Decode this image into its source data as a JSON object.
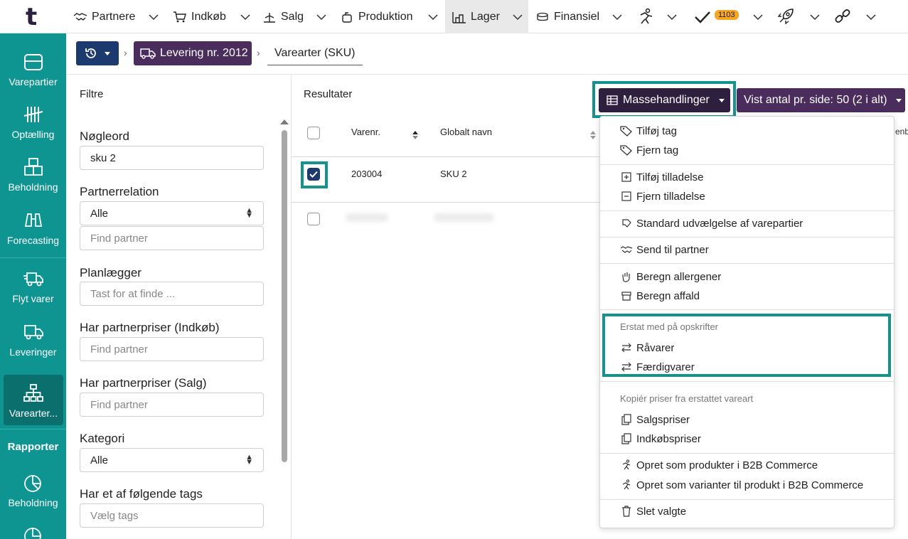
{
  "app": {
    "logo": "t"
  },
  "topnav": {
    "items": [
      {
        "label": "Partnere",
        "icon": "handshake-icon"
      },
      {
        "label": "Indkøb",
        "icon": "cart-icon"
      },
      {
        "label": "Salg",
        "icon": "scale-icon"
      },
      {
        "label": "Produktion",
        "icon": "pot-icon"
      },
      {
        "label": "Lager",
        "icon": "warehouse-icon"
      },
      {
        "label": "Finansiel",
        "icon": "coins-icon"
      }
    ],
    "badge": "1103"
  },
  "sidebar": {
    "items": [
      {
        "label": "Varepartier",
        "icon": "box-icon"
      },
      {
        "label": "Optælling",
        "icon": "tally-icon"
      },
      {
        "label": "Beholdning",
        "icon": "boxes-icon"
      },
      {
        "label": "Forecasting",
        "icon": "binoculars-icon"
      },
      {
        "label": "Flyt varer",
        "icon": "truck-move-icon"
      },
      {
        "label": "Leveringer",
        "icon": "truck-icon"
      },
      {
        "label": "Varearter...",
        "icon": "hierarchy-icon"
      },
      {
        "label": "Beholdning",
        "icon": "pie-chart-icon"
      }
    ],
    "section": "Rapporter"
  },
  "breadcrumb": {
    "delivery": "Levering nr. 2012",
    "current": "Varearter (SKU)"
  },
  "filters": {
    "title": "Filtre",
    "keyword_label": "Nøgleord",
    "keyword_value": "sku 2",
    "partner_relation_label": "Partnerrelation",
    "partner_relation_value": "Alle",
    "find_partner": "Find partner",
    "planner_label": "Planlægger",
    "planner_placeholder": "Tast for at finde ...",
    "partner_prices_purchase_label": "Har partnerpriser (Indkøb)",
    "partner_prices_sales_label": "Har partnerpriser (Salg)",
    "category_label": "Kategori",
    "category_value": "Alle",
    "tags_label": "Har et af følgende tags",
    "tags_placeholder": "Vælg tags"
  },
  "results": {
    "title": "Resultater",
    "mass_actions": "Massehandlinger",
    "per_page": "Vist antal pr. side: 50 (2 i alt)",
    "columns": [
      "Varenr.",
      "Globalt navn"
    ],
    "cut_column": "enb",
    "rows": [
      {
        "varenr": "203004",
        "name": "SKU 2",
        "checked": true
      }
    ]
  },
  "dropdown": {
    "add_tag": "Tilføj tag",
    "remove_tag": "Fjern tag",
    "add_permission": "Tilføj tilladelse",
    "remove_permission": "Fjern tilladelse",
    "default_selection": "Standard udvælgelse af varepartier",
    "send_to_partner": "Send til partner",
    "calc_allergens": "Beregn allergener",
    "calc_waste": "Beregn affald",
    "replace_header": "Erstat med på opskrifter",
    "raw_materials": "Råvarer",
    "finished_goods": "Færdigvarer",
    "copy_header": "Kopiér priser fra erstattet vareart",
    "sales_prices": "Salgspriser",
    "purchase_prices": "Indkøbspriser",
    "create_products": "Opret som produkter i B2B Commerce",
    "create_variants": "Opret som varianter til produkt i B2B Commerce",
    "delete_selected": "Slet valgte"
  },
  "colors": {
    "sidebar": "#0e9491",
    "sidebar_active": "#0b6f6d",
    "primary_dark": "#2d1f3d",
    "purple": "#4a2d5c",
    "navy": "#1d3a6e",
    "highlight": "#15918e",
    "badge": "#f5a623"
  }
}
